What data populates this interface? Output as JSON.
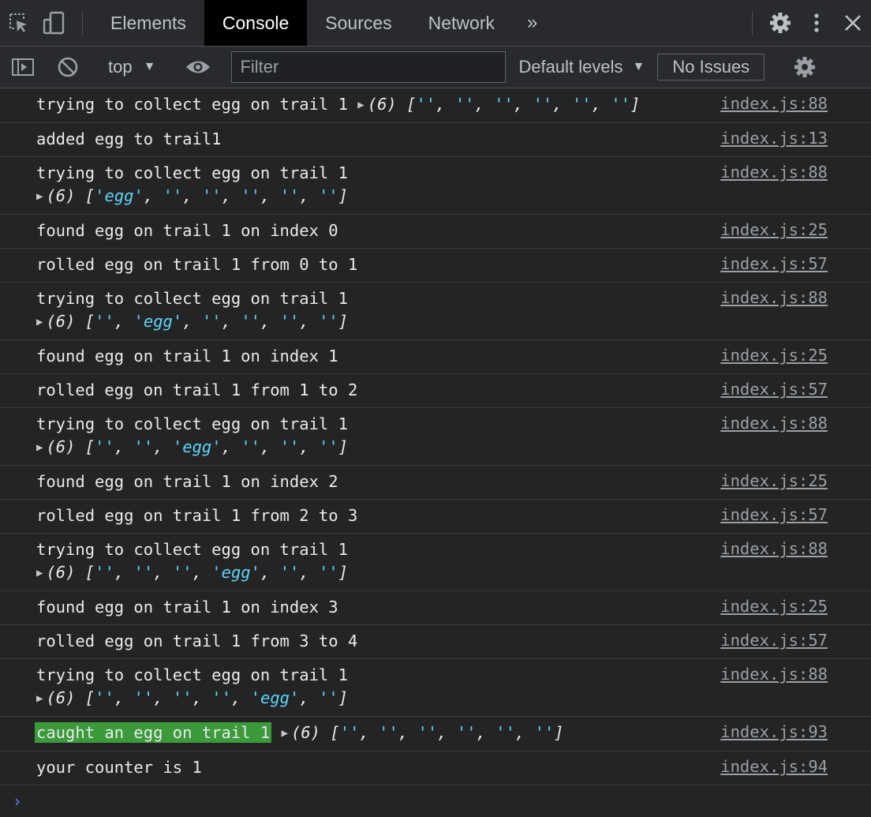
{
  "tabs": [
    {
      "label": "Elements"
    },
    {
      "label": "Console"
    },
    {
      "label": "Sources"
    },
    {
      "label": "Network"
    }
  ],
  "active_tab": "Console",
  "more_tabs_icon": "chevron-double-right",
  "toolbar": {
    "context": "top",
    "filter_placeholder": "Filter",
    "levels": "Default levels",
    "issues": "No Issues"
  },
  "colors": {
    "string": "#5cd5fb",
    "badge_bg": "#3b9a3a",
    "active_tab_bg": "#000000",
    "background": "#242424"
  },
  "messages": [
    {
      "text": "trying to collect egg on trail 1",
      "array": [
        "",
        "",
        "",
        "",
        "",
        ""
      ],
      "array_len": "(6)",
      "inline": true,
      "source": "index.js:88"
    },
    {
      "text": "added egg to trail1",
      "source": "index.js:13"
    },
    {
      "text": "trying to collect egg on trail 1",
      "array": [
        "egg",
        "",
        "",
        "",
        "",
        ""
      ],
      "array_len": "(6)",
      "inline": false,
      "source": "index.js:88"
    },
    {
      "text": "found egg on trail 1 on index 0",
      "source": "index.js:25"
    },
    {
      "text": "rolled egg on trail 1 from 0 to 1",
      "source": "index.js:57"
    },
    {
      "text": "trying to collect egg on trail 1",
      "array": [
        "",
        "egg",
        "",
        "",
        "",
        ""
      ],
      "array_len": "(6)",
      "inline": false,
      "source": "index.js:88"
    },
    {
      "text": "found egg on trail 1 on index 1",
      "source": "index.js:25"
    },
    {
      "text": "rolled egg on trail 1 from 1 to 2",
      "source": "index.js:57"
    },
    {
      "text": "trying to collect egg on trail 1",
      "array": [
        "",
        "",
        "egg",
        "",
        "",
        ""
      ],
      "array_len": "(6)",
      "inline": false,
      "source": "index.js:88"
    },
    {
      "text": "found egg on trail 1 on index 2",
      "source": "index.js:25"
    },
    {
      "text": "rolled egg on trail 1 from 2 to 3",
      "source": "index.js:57"
    },
    {
      "text": "trying to collect egg on trail 1",
      "array": [
        "",
        "",
        "",
        "egg",
        "",
        ""
      ],
      "array_len": "(6)",
      "inline": false,
      "source": "index.js:88"
    },
    {
      "text": "found egg on trail 1 on index 3",
      "source": "index.js:25"
    },
    {
      "text": "rolled egg on trail 1 from 3 to 4",
      "source": "index.js:57"
    },
    {
      "text": "trying to collect egg on trail 1",
      "array": [
        "",
        "",
        "",
        "",
        "egg",
        ""
      ],
      "array_len": "(6)",
      "inline": false,
      "source": "index.js:88"
    },
    {
      "text": "caught an egg on trail 1",
      "styled": true,
      "array": [
        "",
        "",
        "",
        "",
        "",
        ""
      ],
      "array_len": "(6)",
      "inline": true,
      "source": "index.js:93"
    },
    {
      "text": "your counter is 1",
      "source": "index.js:94"
    }
  ],
  "prompt_symbol": "›"
}
